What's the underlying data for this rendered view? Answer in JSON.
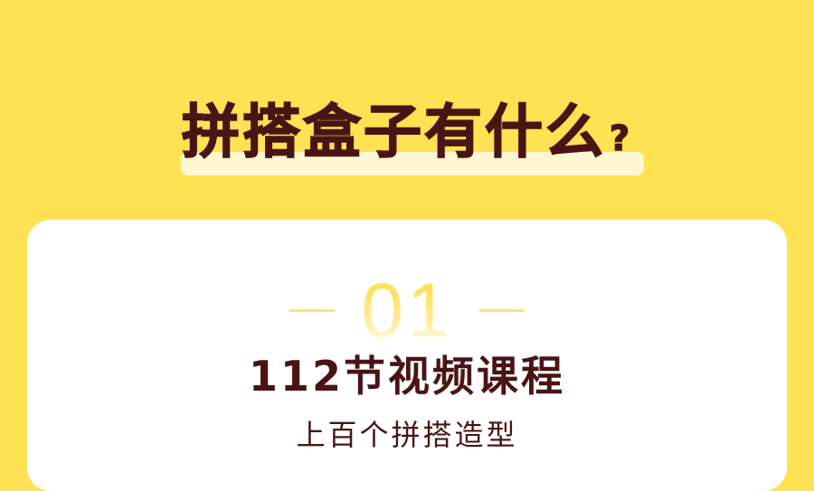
{
  "headline": {
    "text": "拼搭盒子有什么",
    "mark": "?"
  },
  "card": {
    "number": "01",
    "title": "112节视频课程",
    "subtitle": "上百个拼搭造型"
  },
  "colors": {
    "background": "#FFE253",
    "highlight_bar": "#FFF7D2",
    "dark_text": "#4A1414",
    "card": "#FFFFFF",
    "accent_yellow": "#FFD93A"
  }
}
